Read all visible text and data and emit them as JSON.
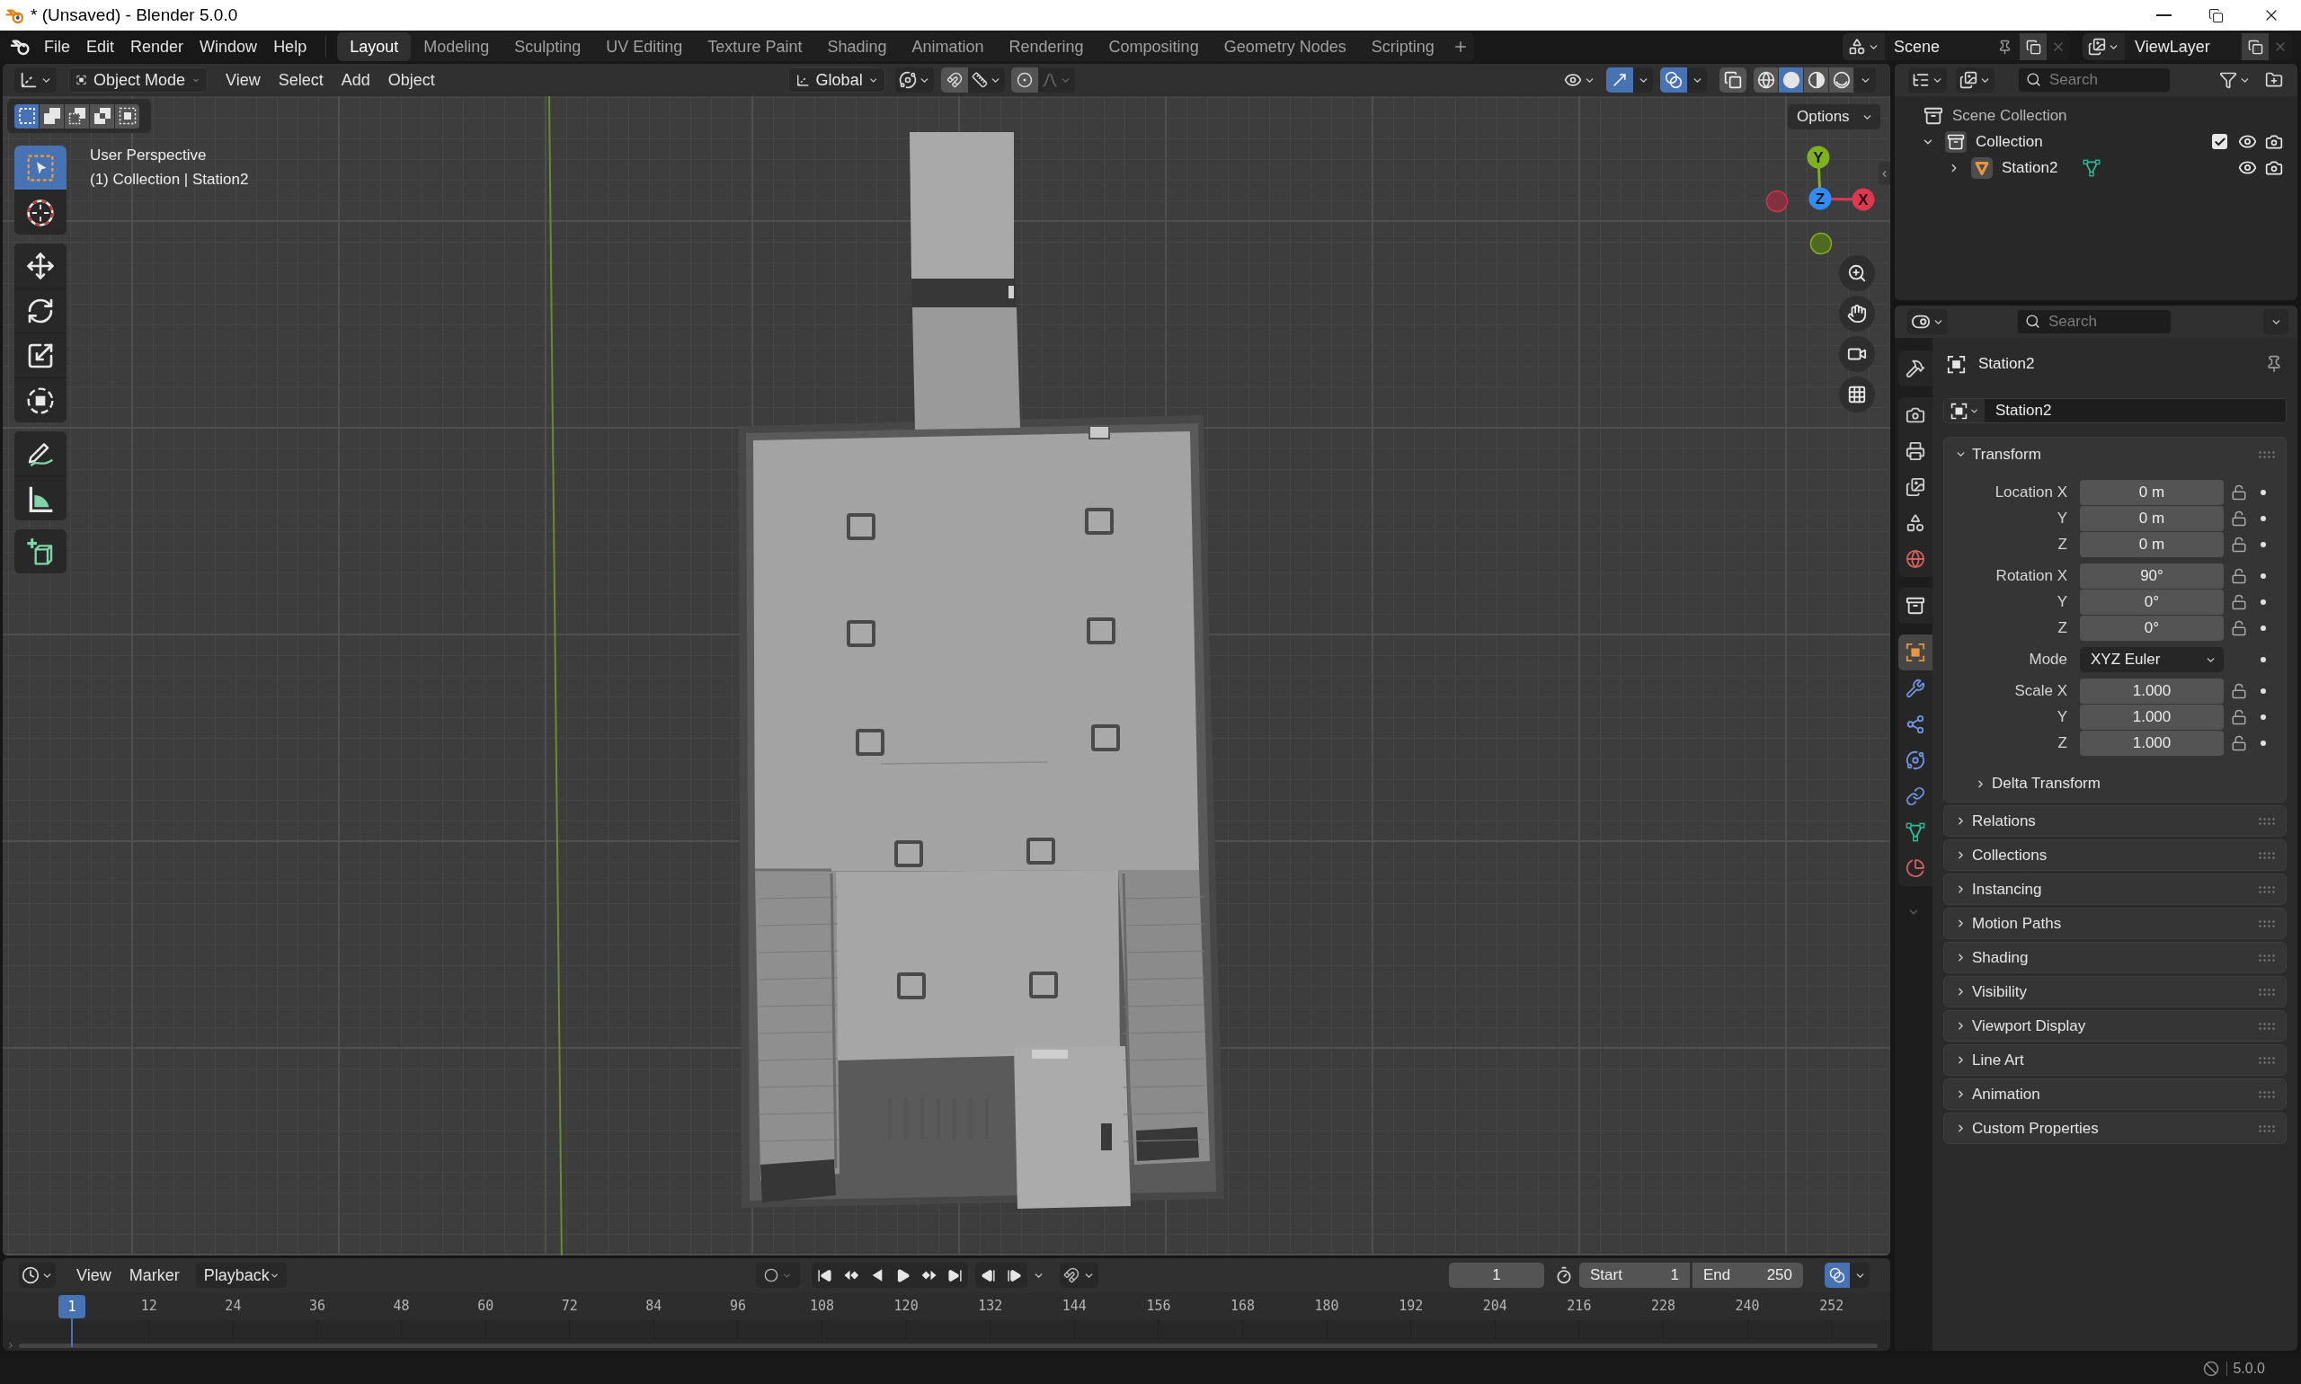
{
  "window": {
    "title": "* (Unsaved) - Blender 5.0.0"
  },
  "menu": [
    "File",
    "Edit",
    "Render",
    "Window",
    "Help"
  ],
  "workspaces": [
    {
      "label": "Layout",
      "selected": true
    },
    {
      "label": "Modeling",
      "selected": false
    },
    {
      "label": "Sculpting",
      "selected": false
    },
    {
      "label": "UV Editing",
      "selected": false
    },
    {
      "label": "Texture Paint",
      "selected": false
    },
    {
      "label": "Shading",
      "selected": false
    },
    {
      "label": "Animation",
      "selected": false
    },
    {
      "label": "Rendering",
      "selected": false
    },
    {
      "label": "Compositing",
      "selected": false
    },
    {
      "label": "Geometry Nodes",
      "selected": false
    },
    {
      "label": "Scripting",
      "selected": false
    }
  ],
  "scene": {
    "value": "Scene"
  },
  "view_layer": {
    "value": "ViewLayer"
  },
  "viewport": {
    "mode": "Object Mode",
    "menus": [
      "View",
      "Select",
      "Add",
      "Object"
    ],
    "orientation": "Global",
    "toggles": [
      {
        "kind": "gizmos",
        "on": true
      },
      {
        "kind": "overlays",
        "on": true
      },
      {
        "kind": "xray",
        "on": false
      }
    ],
    "shading": [
      {
        "kind": "wireframe",
        "selected": false
      },
      {
        "kind": "solid",
        "selected": true
      },
      {
        "kind": "material",
        "selected": false
      },
      {
        "kind": "rendered",
        "selected": false
      }
    ],
    "select_modes": [
      {
        "kind": "set",
        "selected": true
      },
      {
        "kind": "extend",
        "selected": false
      },
      {
        "kind": "subtract",
        "selected": false
      },
      {
        "kind": "invert",
        "selected": false
      },
      {
        "kind": "intersect",
        "selected": false
      }
    ],
    "tool_groups": [
      {
        "tools": [
          {
            "kind": "select_box",
            "selected": true
          },
          {
            "kind": "cursor",
            "selected": false
          }
        ]
      },
      {
        "tools": [
          {
            "kind": "move",
            "selected": false
          },
          {
            "kind": "rotate",
            "selected": false
          },
          {
            "kind": "scale",
            "selected": false
          },
          {
            "kind": "transform",
            "selected": false
          }
        ]
      },
      {
        "tools": [
          {
            "kind": "annotate",
            "selected": false
          },
          {
            "kind": "measure",
            "selected": false
          }
        ]
      },
      {
        "tools": [
          {
            "kind": "add_cube",
            "selected": false
          }
        ]
      }
    ],
    "view_name": "User Perspective",
    "view_info": "(1) Collection | Station2",
    "options": "Options",
    "gizmo_axes": [
      {
        "kind": "y",
        "label": "Y"
      },
      {
        "kind": "z",
        "label": "Z"
      },
      {
        "kind": "x",
        "label": "X"
      }
    ]
  },
  "outliner": {
    "search": {
      "placeholder": "Search"
    },
    "tree": [
      {
        "kind": "scene_collection",
        "label": "Scene Collection",
        "children": [
          {
            "kind": "collection",
            "label": "Collection",
            "expanded": true,
            "checked": true,
            "visible": true,
            "renderable": true,
            "children": [
              {
                "kind": "object",
                "label": "Station2",
                "expanded": false,
                "visible": true,
                "renderable": true
              }
            ]
          }
        ]
      }
    ]
  },
  "properties": {
    "search": {
      "placeholder": "Search"
    },
    "tab_groups": [
      {
        "tabs": [
          {
            "kind": "tool",
            "selected": false
          }
        ]
      },
      {
        "tabs": [
          {
            "kind": "render",
            "selected": false
          },
          {
            "kind": "output",
            "selected": false
          },
          {
            "kind": "view_layer",
            "selected": false
          },
          {
            "kind": "scene",
            "selected": false
          },
          {
            "kind": "world",
            "selected": false
          }
        ]
      },
      {
        "tabs": [
          {
            "kind": "collection",
            "selected": false
          }
        ]
      },
      {
        "tabs": [
          {
            "kind": "object",
            "selected": true
          },
          {
            "kind": "modifiers",
            "selected": false
          },
          {
            "kind": "particles",
            "selected": false
          },
          {
            "kind": "physics",
            "selected": false
          },
          {
            "kind": "constraints",
            "selected": false
          },
          {
            "kind": "data",
            "selected": false
          },
          {
            "kind": "material",
            "selected": false
          }
        ]
      }
    ],
    "object_name": "Station2",
    "name_field": "Station2",
    "panels": [
      {
        "title": "Transform",
        "expanded": true,
        "groups": [
          {
            "rows": [
              {
                "kind": "number",
                "label": "Location X",
                "value": "0 m",
                "locked": false
              },
              {
                "kind": "number",
                "label": "Y",
                "value": "0 m",
                "locked": false
              },
              {
                "kind": "number",
                "label": "Z",
                "value": "0 m",
                "locked": false
              }
            ]
          },
          {
            "rows": [
              {
                "kind": "number",
                "label": "Rotation X",
                "value": "90°",
                "locked": false
              },
              {
                "kind": "number",
                "label": "Y",
                "value": "0°",
                "locked": false
              },
              {
                "kind": "number",
                "label": "Z",
                "value": "0°",
                "locked": false
              }
            ]
          },
          {
            "rows": [
              {
                "kind": "dropdown",
                "label": "Mode",
                "value": "XYZ Euler"
              }
            ]
          },
          {
            "rows": [
              {
                "kind": "number",
                "label": "Scale X",
                "value": "1.000",
                "locked": false
              },
              {
                "kind": "number",
                "label": "Y",
                "value": "1.000",
                "locked": false
              },
              {
                "kind": "number",
                "label": "Z",
                "value": "1.000",
                "locked": false
              }
            ]
          }
        ],
        "subpanels": [
          {
            "title": "Delta Transform",
            "expanded": false
          }
        ]
      },
      {
        "title": "Relations",
        "expanded": false
      },
      {
        "title": "Collections",
        "expanded": false
      },
      {
        "title": "Instancing",
        "expanded": false
      },
      {
        "title": "Motion Paths",
        "expanded": false
      },
      {
        "title": "Shading",
        "expanded": false
      },
      {
        "title": "Visibility",
        "expanded": false
      },
      {
        "title": "Viewport Display",
        "expanded": false
      },
      {
        "title": "Line Art",
        "expanded": false
      },
      {
        "title": "Animation",
        "expanded": false
      },
      {
        "title": "Custom Properties",
        "expanded": false
      }
    ]
  },
  "timeline": {
    "menus": [
      "View",
      "Marker"
    ],
    "playback": "Playback",
    "current_frame": "1",
    "start_label": "Start",
    "start": "1",
    "end_label": "End",
    "end": "250",
    "frame_marker": "1",
    "ticks": [
      "12",
      "24",
      "36",
      "48",
      "60",
      "72",
      "84",
      "96",
      "108",
      "120",
      "132",
      "144",
      "156",
      "168",
      "180",
      "192",
      "204",
      "216",
      "228",
      "240",
      "252"
    ],
    "toggle": {
      "on": true
    }
  },
  "status_bar": {
    "version": "5.0.0"
  }
}
